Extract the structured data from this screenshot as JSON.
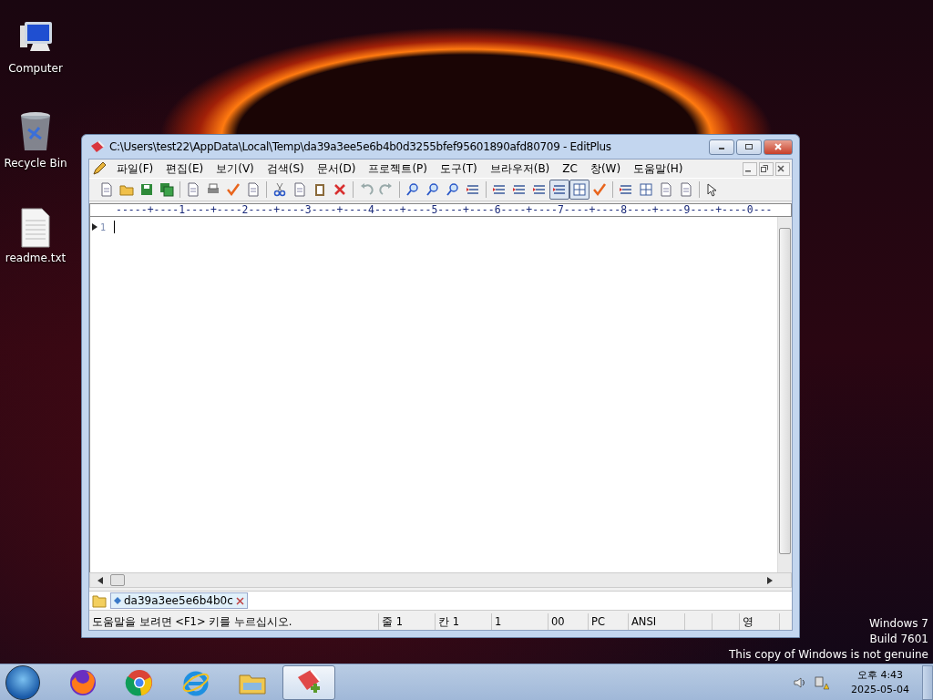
{
  "desktop": {
    "icons": [
      {
        "label": "Computer",
        "kind": "computer"
      },
      {
        "label": "Recycle Bin",
        "kind": "recycle"
      },
      {
        "label": "readme.txt",
        "kind": "file"
      }
    ],
    "notice": [
      "Windows 7",
      "Build 7601",
      "This copy of Windows is not genuine"
    ]
  },
  "window": {
    "title": "C:\\Users\\test22\\AppData\\Local\\Temp\\da39a3ee5e6b4b0d3255bfef95601890afd80709 - EditPlus"
  },
  "menu": [
    "파일(F)",
    "편집(E)",
    "보기(V)",
    "검색(S)",
    "문서(D)",
    "프로젝트(P)",
    "도구(T)",
    "브라우저(B)",
    "ZC",
    "창(W)",
    "도움말(H)"
  ],
  "toolbar": [
    {
      "kind": "button"
    },
    {
      "kind": "button"
    },
    {
      "kind": "button"
    },
    {
      "kind": "button"
    },
    {
      "kind": "separator"
    },
    {
      "kind": "button"
    },
    {
      "kind": "button"
    },
    {
      "kind": "button"
    },
    {
      "kind": "button"
    },
    {
      "kind": "separator"
    },
    {
      "kind": "button"
    },
    {
      "kind": "button"
    },
    {
      "kind": "button"
    },
    {
      "kind": "button"
    },
    {
      "kind": "separator"
    },
    {
      "kind": "button"
    },
    {
      "kind": "button"
    },
    {
      "kind": "separator"
    },
    {
      "kind": "button"
    },
    {
      "kind": "button"
    },
    {
      "kind": "button"
    },
    {
      "kind": "button"
    },
    {
      "kind": "separator"
    },
    {
      "kind": "button"
    },
    {
      "kind": "button"
    },
    {
      "kind": "button"
    },
    {
      "kind": "toggle",
      "pressed": true
    },
    {
      "kind": "toggle",
      "pressed": true
    },
    {
      "kind": "button"
    },
    {
      "kind": "separator"
    },
    {
      "kind": "button"
    },
    {
      "kind": "button"
    },
    {
      "kind": "button"
    },
    {
      "kind": "button"
    },
    {
      "kind": "separator"
    },
    {
      "kind": "button"
    }
  ],
  "ruler": "-----+----1----+----2----+----3----+----4----+----5----+----6----+----7----+----8----+----9----+----0---",
  "editor": {
    "lines": [
      {
        "number": "1"
      }
    ]
  },
  "document_tabs": [
    {
      "label": "da39a3ee5e6b4b0c",
      "selected": true
    }
  ],
  "status_bar": [
    "도움말을 보려면 <F1> 키를 누르십시오.",
    "줄 1",
    "칸 1",
    "1",
    "00",
    "PC",
    "ANSI",
    "영"
  ],
  "taskbar": {
    "apps": [
      {
        "kind": "firefox",
        "selected": false
      },
      {
        "kind": "chrome",
        "selected": false
      },
      {
        "kind": "ie",
        "selected": false
      },
      {
        "kind": "explorer",
        "selected": false
      },
      {
        "kind": "editplus",
        "selected": true
      }
    ],
    "clock": {
      "time": "오후 4:43",
      "date": "2025-05-04"
    }
  }
}
